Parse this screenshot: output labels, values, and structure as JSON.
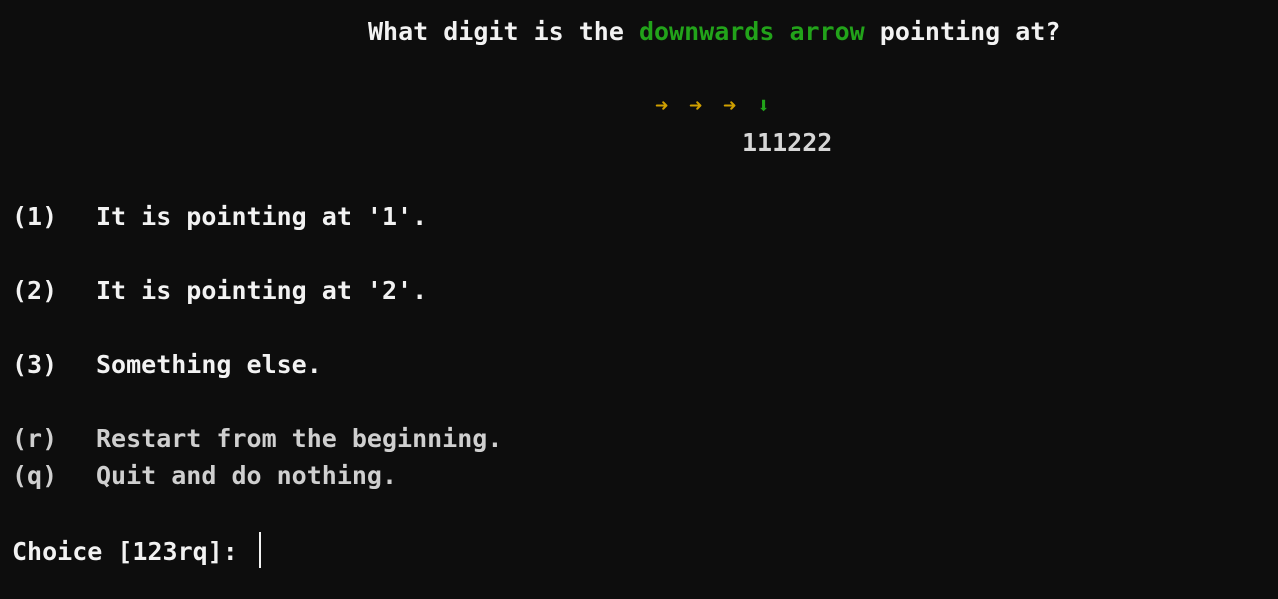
{
  "question": {
    "prefix": "What digit is the ",
    "highlight": "downwards arrow",
    "suffix": " pointing at?"
  },
  "arrows": {
    "right_glyph": "➜",
    "down_glyph": "⬇",
    "colors": {
      "right": "#d0a000",
      "down": "#22a31a"
    }
  },
  "digits": "111222",
  "options": [
    {
      "key": "(1)",
      "label": "It is pointing at '1'."
    },
    {
      "key": "(2)",
      "label": "It is pointing at '2'."
    },
    {
      "key": "(3)",
      "label": "Something else."
    },
    {
      "key": "(r)",
      "label": "Restart from the beginning."
    },
    {
      "key": "(q)",
      "label": "Quit and do nothing."
    }
  ],
  "prompt": "Choice [123rq]: "
}
